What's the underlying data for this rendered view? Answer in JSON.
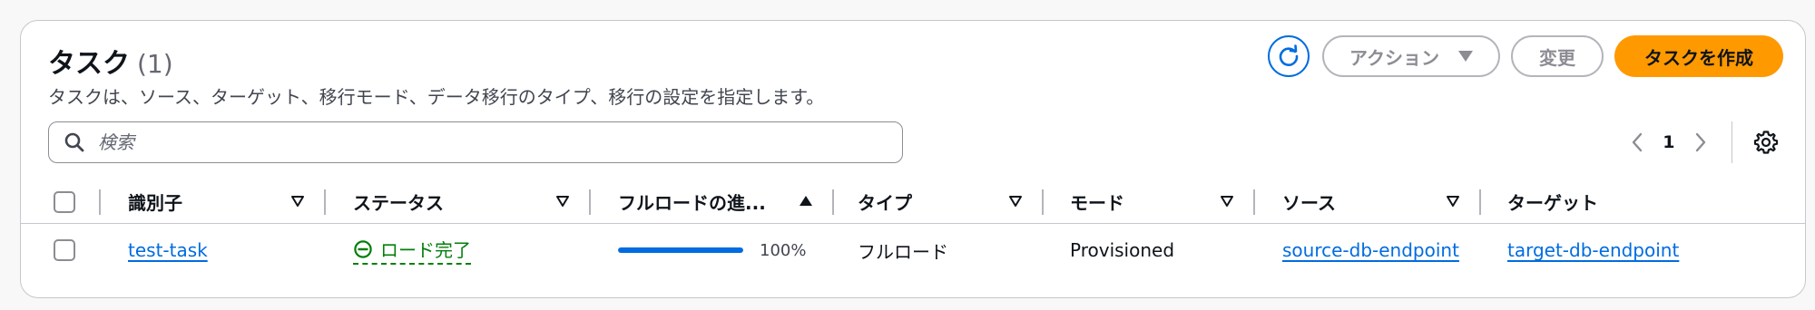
{
  "header": {
    "title": "タスク",
    "count": "(1)",
    "description": "タスクは、ソース、ターゲット、移行モード、データ移行のタイプ、移行の設定を指定します。"
  },
  "toolbar": {
    "refresh_icon": "refresh-icon",
    "action_label": "アクション",
    "edit_label": "変更",
    "create_label": "タスクを作成"
  },
  "search": {
    "placeholder": "検索",
    "value": ""
  },
  "pagination": {
    "current_page": "1"
  },
  "table": {
    "columns": [
      {
        "label": "識別子",
        "sort": "none"
      },
      {
        "label": "ステータス",
        "sort": "none"
      },
      {
        "label": "フルロードの進...",
        "sort": "ascending"
      },
      {
        "label": "タイプ",
        "sort": "none"
      },
      {
        "label": "モード",
        "sort": "none"
      },
      {
        "label": "ソース",
        "sort": "none"
      },
      {
        "label": "ターゲット",
        "sort": "none"
      }
    ],
    "rows": [
      {
        "identifier": "test-task",
        "status": "ロード完了",
        "progress_percent": 100,
        "progress_label": "100%",
        "type": "フルロード",
        "mode": "Provisioned",
        "source": "source-db-endpoint",
        "target": "target-db-endpoint"
      }
    ]
  },
  "colors": {
    "primary": "#ff9900",
    "link": "#006ce0",
    "success": "#037f0c",
    "border": "#c6c6cd",
    "disabled": "#8c8c94"
  }
}
